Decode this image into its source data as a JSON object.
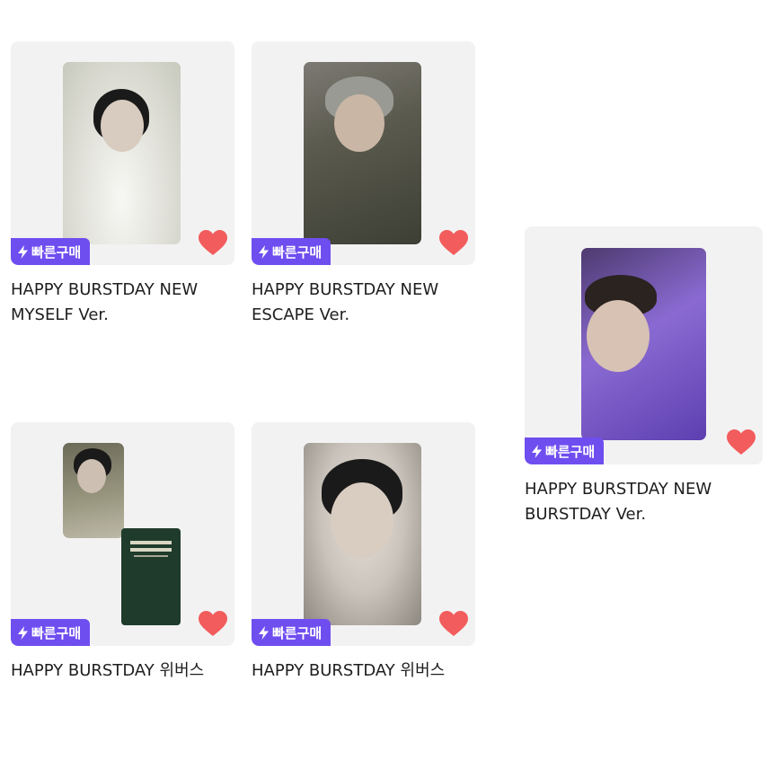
{
  "badge_label": "빠른구매",
  "colors": {
    "badge": "#6f4ef0",
    "heart": "#f25c5c",
    "thumb_bg": "#f3f2f3"
  },
  "products": [
    {
      "title_line1": "HAPPY BURSTDAY NEW",
      "title_line2": "MYSELF Ver."
    },
    {
      "title_line1": "HAPPY BURSTDAY NEW",
      "title_line2": "ESCAPE Ver."
    },
    {
      "title_line1": "HAPPY BURSTDAY NEW",
      "title_line2": "BURSTDAY Ver."
    },
    {
      "title_line1": "HAPPY BURSTDAY 위버스",
      "title_line2": ""
    },
    {
      "title_line1": "HAPPY BURSTDAY 위버스",
      "title_line2": ""
    }
  ]
}
